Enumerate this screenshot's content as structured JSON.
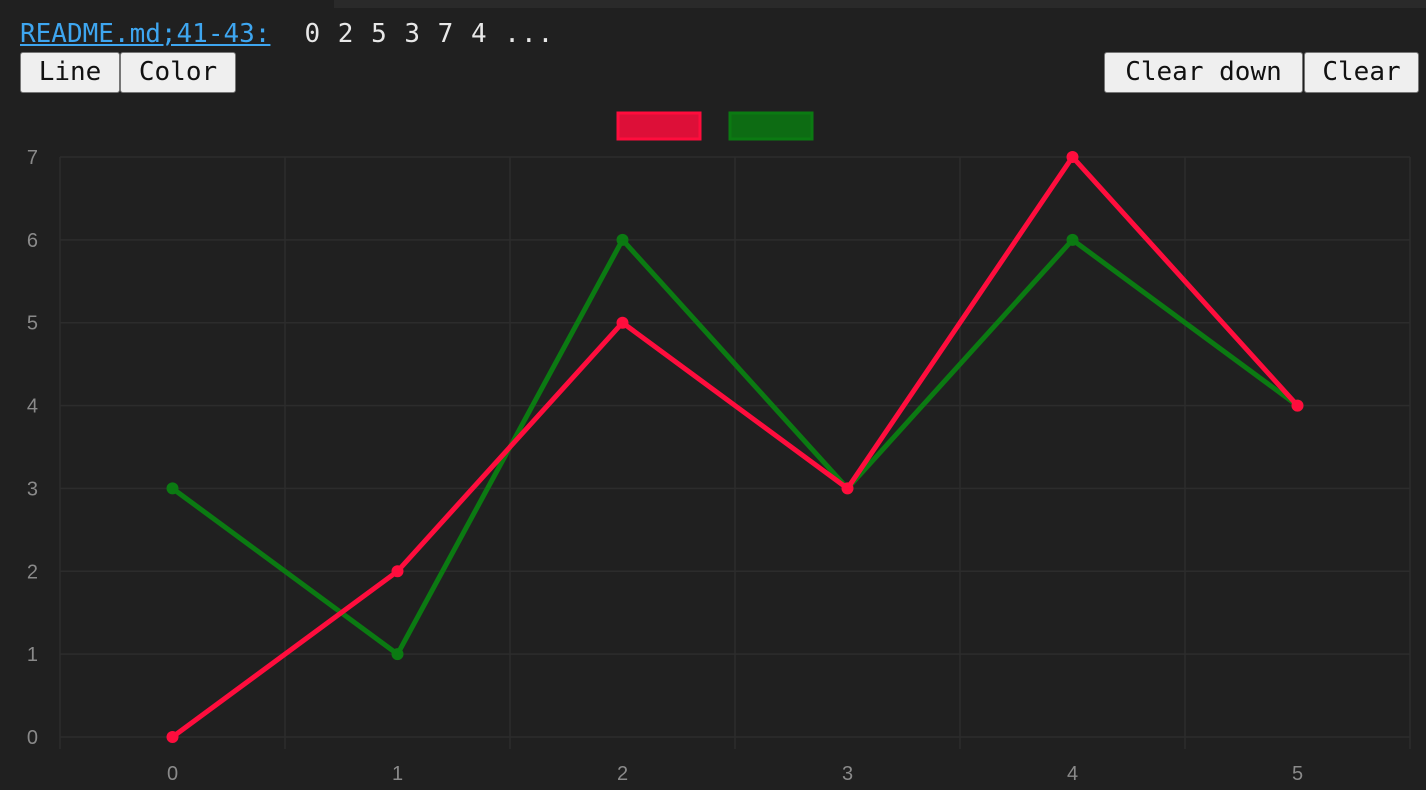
{
  "source": {
    "link_text": "README.md;41-43:",
    "values_text": "0 2 5 3 7 4 ..."
  },
  "toolbar": {
    "line_label": "Line",
    "color_label": "Color",
    "clear_down_label": "Clear down",
    "clear_label": "Clear"
  },
  "colors": {
    "background": "#202020",
    "grid": "#2c2c2c",
    "tick_text": "#8a8a8a",
    "link": "#3ea6f0"
  },
  "chart_data": {
    "type": "line",
    "x": [
      0,
      1,
      2,
      3,
      4,
      5
    ],
    "xlim": [
      -0.5,
      5.5
    ],
    "ylim": [
      0,
      7
    ],
    "xticks": [
      "0",
      "1",
      "2",
      "3",
      "4",
      "5"
    ],
    "yticks": [
      "0",
      "1",
      "2",
      "3",
      "4",
      "5",
      "6",
      "7"
    ],
    "grid": true,
    "legend": "top-center",
    "series": [
      {
        "color": "#ff0d3d",
        "values": [
          0,
          2,
          5,
          3,
          7,
          4
        ]
      },
      {
        "color": "#0b7a12",
        "values": [
          3,
          1,
          6,
          3,
          6,
          4
        ]
      }
    ]
  }
}
